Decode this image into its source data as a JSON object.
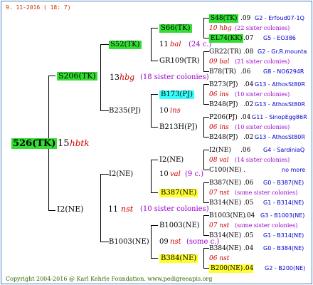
{
  "header": "9. 11-2016 ( 18: 7)",
  "footer": "Copyright 2004-2016 @ Karl Kehrle Foundation.   www.pedigreeapis.org",
  "colors": {
    "green": "#33dd33",
    "yellow": "#ffff33",
    "cyan": "#33ffff",
    "red": "#cc0000",
    "blue": "#0000cc",
    "purple": "#9900cc",
    "border": "#4a7fbf"
  },
  "root": {
    "name": "526(TK)",
    "num": "15",
    "tag": "hbtk"
  },
  "g1": [
    {
      "name": "S206(TK)",
      "num": "13",
      "tag": "hbg",
      "note": "(18 sister colonies)"
    },
    {
      "name": "I2(NE)",
      "num": "11",
      "tag": "nst",
      "note": "(10 sister colonies)"
    }
  ],
  "g2": [
    {
      "name": "S52(TK)"
    },
    {
      "name": "B235(PJ)",
      "num": "10",
      "tag": "ins"
    },
    {
      "name": "I2(NE)",
      "num": "10",
      "tag": "val",
      "note": "(9 c.)"
    },
    {
      "name": "B1003(NE)",
      "num": "09",
      "tag": "nst",
      "note": "(some c.)"
    }
  ],
  "g3": [
    {
      "name": "S66(TK)"
    },
    {
      "name": "GR109(TR)"
    },
    {
      "name": "B173(PJ)"
    },
    {
      "name": "B213H(PJ)"
    },
    {
      "name": "I2(NE)"
    },
    {
      "name": "B387(NE)"
    },
    {
      "name": "B1003(NE)"
    },
    {
      "name": "B384(NE)"
    }
  ],
  "s52_line": {
    "num": "11",
    "tag": "bal",
    "note": "(24 c.)"
  },
  "g4": [
    {
      "name": "S48(TK)",
      "n": ".09",
      "code": "G2 - Erfoud07-1Q"
    },
    {
      "tag": "10 hbg",
      "note": "(22 sister colonies)"
    },
    {
      "name": "EL74(KK)",
      "n": ".07",
      "code": "G5 - EO386"
    },
    {
      "name": "GR22(TR)",
      "n": ".08",
      "code": "G2 - Gr.R.mounta"
    },
    {
      "tag": "09 bal",
      "note": "(21 sister colonies)"
    },
    {
      "name": "B78(TR)",
      "n": ".06",
      "code": "G8 - NO6294R"
    },
    {
      "name": "B273(PJ)",
      "n": ".04",
      "code": "G13 - AthosSt80R"
    },
    {
      "tag": "06 ins",
      "note": "(10 sister colonies)"
    },
    {
      "name": "B248(PJ)",
      "n": ".02",
      "code": "G13 - AthosSt80R"
    },
    {
      "name": "P206(PJ)",
      "n": ".04",
      "code": "G11 - SinopEgg86R"
    },
    {
      "tag": "06 ins",
      "note": "(10 sister colonies)"
    },
    {
      "name": "B248(PJ)",
      "n": ".02",
      "code": "G13 - AthosSt80R"
    },
    {
      "name": "I2(NE)",
      "n": ".06",
      "code": "G4 - SardiniaQ"
    },
    {
      "tag": "08 val",
      "note": "(14 sister colonies)"
    },
    {
      "name": "C100(NE)",
      "n": ".",
      "code": "no more"
    },
    {
      "name": "B387(NE)",
      "n": ".06",
      "code": "G0 - B387(NE)"
    },
    {
      "tag": "07 nst",
      "note": "(some sister colonies)"
    },
    {
      "name": "B314(NE)",
      "n": ".05",
      "code": "G1 - B314(NE)"
    },
    {
      "name": "B1003(NE)",
      "n": ".04",
      "code": "G3 - B1003(NE)"
    },
    {
      "tag": "07 nst",
      "note": "(some sister colonies)"
    },
    {
      "name": "B314(NE)",
      "n": ".05",
      "code": "G1 - B314(NE)"
    },
    {
      "name": "B384(NE)",
      "n": ".04",
      "code": "G0 - B384(NE)"
    },
    {
      "tag": "06 nst",
      "note": ""
    },
    {
      "name": "B200(NE)",
      "n": ".04",
      "code": "G2 - B200(NE)"
    }
  ]
}
